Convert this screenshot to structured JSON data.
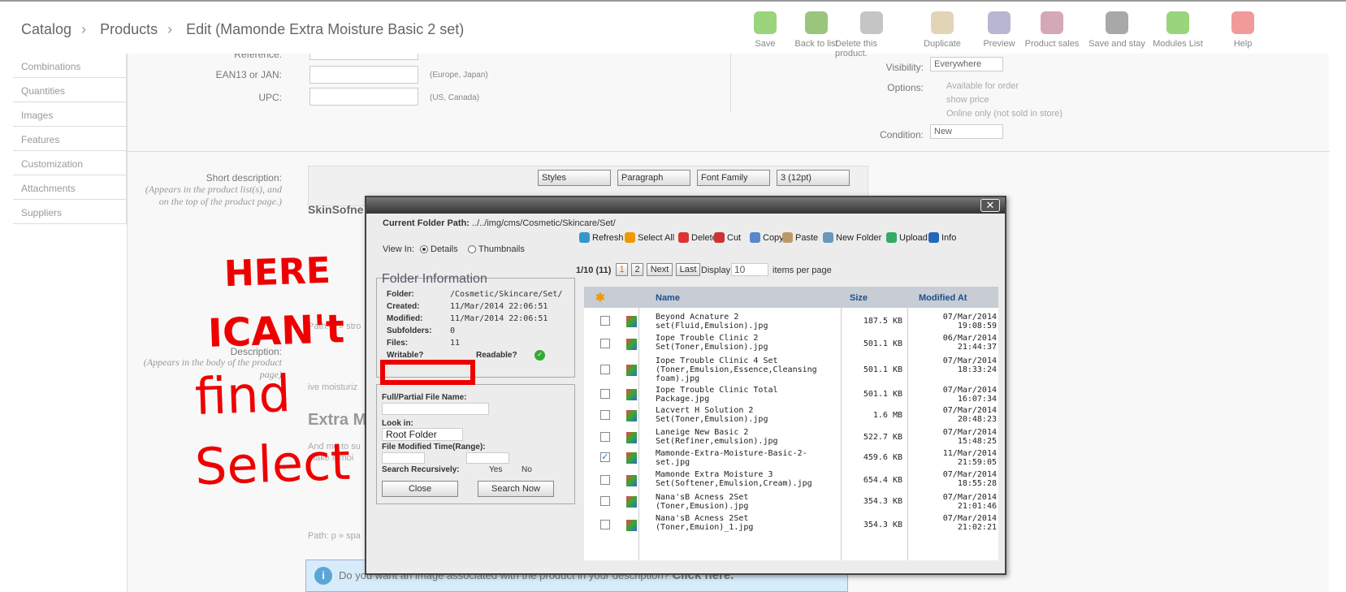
{
  "breadcrumb": [
    "Catalog",
    "Products",
    "Edit (Mamonde Extra Moisture Basic 2 set)"
  ],
  "toolbar": [
    {
      "label": "Save",
      "icon": "save-check-icon"
    },
    {
      "label": "Back to list",
      "icon": "back-arrow-icon"
    },
    {
      "label": "Delete this product.",
      "icon": "trash-icon"
    },
    {
      "label": "Duplicate",
      "icon": "duplicate-icon"
    },
    {
      "label": "Preview",
      "icon": "preview-icon"
    },
    {
      "label": "Product sales",
      "icon": "chart-icon"
    },
    {
      "label": "Save and stay",
      "icon": "floppy-icon"
    },
    {
      "label": "Modules List",
      "icon": "puzzle-icon"
    },
    {
      "label": "Help",
      "icon": "lifebuoy-icon"
    }
  ],
  "sidebar": [
    "Combinations",
    "Quantities",
    "Images",
    "Features",
    "Customization",
    "Attachments",
    "Suppliers"
  ],
  "form": {
    "reference": "Reference:",
    "ean": "EAN13 or JAN:",
    "ean_note": "(Europe, Japan)",
    "upc": "UPC:",
    "upc_note": "(US, Canada)",
    "visibility": "Visibility:",
    "visibility_value": "Everywhere",
    "options": "Options:",
    "opt1": "Available for order",
    "opt2": "show price",
    "opt3": "Online only (not sold in store)",
    "condition": "Condition:",
    "condition_value": "New",
    "short_desc": "Short description:",
    "short_desc_hint": "(Appears in the product list(s), and on the top of the product page.)",
    "description": "Description:",
    "description_hint": "(Appears in the body of the product page)",
    "editor_styles": "Styles",
    "editor_paragraph": "Paragraph",
    "editor_font": "Font Family",
    "editor_size": "3 (12pt)",
    "frag1": "SkinSofne",
    "frag2": "Path: p » stro",
    "frag3": "ive moisturiz",
    "frag4": "Extra M",
    "frag5": "And me to su",
    "frag6": "make it moi",
    "frag7": "Path: p » spa",
    "info_text": "Do you want an image associated with the product in your description?",
    "info_link": "Click here."
  },
  "modal": {
    "path_label": "Current Folder Path:",
    "path_value": "../../img/cms/Cosmetic/Skincare/Set/",
    "actions": [
      "Refresh",
      "Select All",
      "Delete",
      "Cut",
      "Copy",
      "Paste",
      "New Folder",
      "Upload",
      "Info"
    ],
    "view_in": "View In:",
    "view_details": "Details",
    "view_thumbs": "Thumbnails",
    "folder_info_title": "Folder Information",
    "folder_label": "Folder:",
    "folder_value": "/Cosmetic/Skincare/Set/",
    "created_label": "Created:",
    "created_value": "11/Mar/2014 22:06:51",
    "modified_label": "Modified:",
    "modified_value": "11/Mar/2014 22:06:51",
    "subfolders_label": "Subfolders:",
    "subfolders_value": "0",
    "files_label": "Files:",
    "files_value": "11",
    "writable_label": "Writable?",
    "readable_label": "Readable?",
    "search_name_label": "Full/Partial File Name:",
    "look_in_label": "Look in:",
    "look_in_value": "Root Folder",
    "modified_range_label": "File Modified Time(Range):",
    "recursive_label": "Search Recursively:",
    "yes": "Yes",
    "no": "No",
    "close_btn": "Close",
    "search_btn": "Search Now",
    "pager": "1/10 (11)",
    "page1": "1",
    "page2": "2",
    "next": "Next",
    "last": "Last",
    "display": "Display",
    "display_value": "10",
    "per_page": "items per page",
    "col_name": "Name",
    "col_size": "Size",
    "col_modified": "Modified At",
    "files": [
      {
        "name": "Beyond Acnature 2 set(Fluid,Emulsion).jpg",
        "size": "187.5 KB",
        "date": "07/Mar/2014",
        "time": "19:08:59",
        "checked": false
      },
      {
        "name": "Iope Trouble Clinic 2 Set(Toner,Emulsion).jpg",
        "size": "501.1 KB",
        "date": "06/Mar/2014",
        "time": "21:44:37",
        "checked": false
      },
      {
        "name": "Iope Trouble Clinic 4 Set (Toner,Emulsion,Essence,Cleansing foam).jpg",
        "size": "501.1 KB",
        "date": "07/Mar/2014",
        "time": "18:33:24",
        "checked": false
      },
      {
        "name": "Iope Trouble Clinic Total Package.jpg",
        "size": "501.1 KB",
        "date": "07/Mar/2014",
        "time": "16:07:34",
        "checked": false
      },
      {
        "name": "Lacvert H Solution 2 Set(Toner,Emulsion).jpg",
        "size": "1.6 MB",
        "date": "07/Mar/2014",
        "time": "20:48:23",
        "checked": false
      },
      {
        "name": "Laneige New Basic 2 Set(Refiner,emulsion).jpg",
        "size": "522.7 KB",
        "date": "07/Mar/2014",
        "time": "15:48:25",
        "checked": false
      },
      {
        "name": "Mamonde-Extra-Moisture-Basic-2-set.jpg",
        "size": "459.6 KB",
        "date": "11/Mar/2014",
        "time": "21:59:05",
        "checked": true
      },
      {
        "name": "Mamonde Extra Moisture 3 Set(Softener,Emulsion,Cream).jpg",
        "size": "654.4 KB",
        "date": "07/Mar/2014",
        "time": "18:55:28",
        "checked": false
      },
      {
        "name": "Nana'sB Acness 2Set (Toner,Emusion).jpg",
        "size": "354.3 KB",
        "date": "07/Mar/2014",
        "time": "21:01:46",
        "checked": false
      },
      {
        "name": "Nana'sB Acness 2Set (Toner,Emuion)_1.jpg",
        "size": "354.3 KB",
        "date": "07/Mar/2014",
        "time": "21:02:21",
        "checked": false
      }
    ]
  },
  "annotation": {
    "line1": "HERE",
    "line2": "ICAN't",
    "line3": "find",
    "line4": "Select"
  }
}
